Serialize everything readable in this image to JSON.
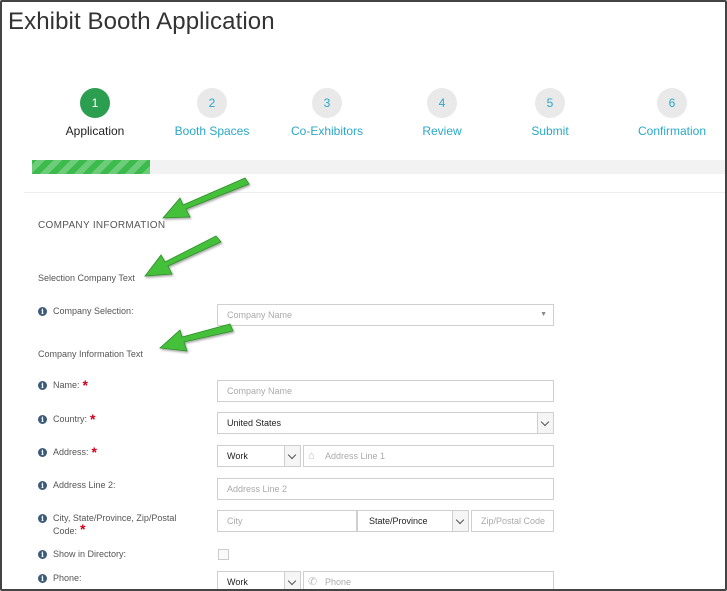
{
  "page": {
    "title": "Exhibit Booth Application"
  },
  "steps": [
    {
      "number": "1",
      "label": "Application",
      "state": "active"
    },
    {
      "number": "2",
      "label": "Booth Spaces",
      "state": "pending"
    },
    {
      "number": "3",
      "label": "Co-Exhibitors",
      "state": "pending"
    },
    {
      "number": "4",
      "label": "Review",
      "state": "pending"
    },
    {
      "number": "5",
      "label": "Submit",
      "state": "pending"
    },
    {
      "number": "6",
      "label": "Confirmation",
      "state": "pending"
    }
  ],
  "progress": {
    "percent": 17
  },
  "form": {
    "section_title": "COMPANY INFORMATION",
    "selection_text": "Selection Company Text",
    "info_text": "Company Information Text",
    "company_selection": {
      "label": "Company Selection:",
      "placeholder": "Company Name"
    },
    "name": {
      "label": "Name:",
      "placeholder": "Company Name"
    },
    "country": {
      "label": "Country:",
      "value": "United States"
    },
    "address": {
      "label": "Address:",
      "type": "Work",
      "placeholder": "Address Line 1"
    },
    "address2": {
      "label": "Address Line 2:",
      "placeholder": "Address Line 2"
    },
    "city_state_zip": {
      "label": "City, State/Province, Zip/Postal Code:",
      "city_placeholder": "City",
      "state_value": "State/Province",
      "zip_placeholder": "Zip/Postal Code"
    },
    "show_in_directory": {
      "label": "Show in Directory:"
    },
    "phone": {
      "label": "Phone:",
      "type": "Work",
      "placeholder": "Phone"
    }
  },
  "colors": {
    "accent": "#2c9e4f",
    "link": "#2aa8c8",
    "progress": "#3cbb4c",
    "required": "#d0021b",
    "annotation_arrow": "#44c03a"
  },
  "icons": {
    "info": "info-icon",
    "address": "home-icon",
    "phone": "phone-icon"
  }
}
